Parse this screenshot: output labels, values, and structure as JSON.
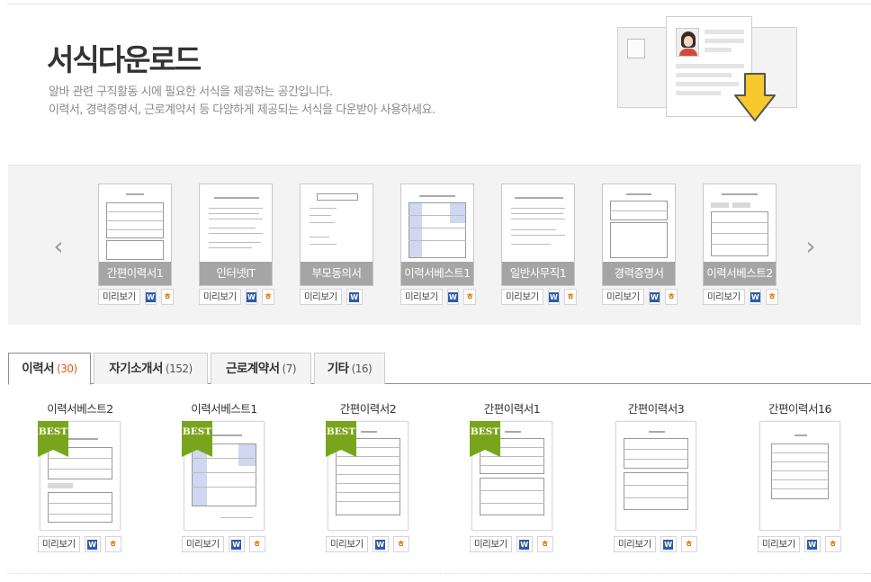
{
  "header": {
    "title": "서식다운로드",
    "desc_line1": "알바 관련 구직활동 시에 필요한 서식을 제공하는 공간입니다.",
    "desc_line2": "이력서, 경력증명서, 근로계약서 등 다양하게 제공되는 서식을 다운받아 사용하세요."
  },
  "carousel": {
    "prev_icon": "chevron-left-icon",
    "next_icon": "chevron-right-icon",
    "items": [
      {
        "label": "간편이력서1",
        "preview": "미리보기",
        "hwp": true
      },
      {
        "label": "인터넷IT",
        "preview": "미리보기",
        "hwp": true
      },
      {
        "label": "부모동의서",
        "preview": "미리보기",
        "hwp": false
      },
      {
        "label": "이력서베스트1",
        "preview": "미리보기",
        "hwp": true
      },
      {
        "label": "일반사무직1",
        "preview": "미리보기",
        "hwp": true
      },
      {
        "label": "경력증명서",
        "preview": "미리보기",
        "hwp": true
      },
      {
        "label": "이력서베스트2",
        "preview": "미리보기",
        "hwp": true
      }
    ]
  },
  "tabs": [
    {
      "label": "이력서",
      "count": "(30)",
      "active": true
    },
    {
      "label": "자기소개서",
      "count": "(152)",
      "active": false
    },
    {
      "label": "근로계약서",
      "count": "(7)",
      "active": false
    },
    {
      "label": "기타",
      "count": "(16)",
      "active": false
    }
  ],
  "grid": {
    "best_label": "BEST",
    "items": [
      {
        "title": "이력서베스트2",
        "best": true,
        "preview": "미리보기"
      },
      {
        "title": "이력서베스트1",
        "best": true,
        "preview": "미리보기"
      },
      {
        "title": "간편이력서2",
        "best": true,
        "preview": "미리보기"
      },
      {
        "title": "간편이력서1",
        "best": true,
        "preview": "미리보기"
      },
      {
        "title": "간편이력서3",
        "best": false,
        "preview": "미리보기"
      },
      {
        "title": "간편이력서16",
        "best": false,
        "preview": "미리보기"
      }
    ]
  },
  "icons": {
    "word": "W",
    "hwp": "ㅎ"
  },
  "colors": {
    "accent_count": "#e2541b",
    "best_ribbon": "#79a51c",
    "word_blue": "#2b5aa8",
    "hwp_orange": "#e07b10"
  }
}
